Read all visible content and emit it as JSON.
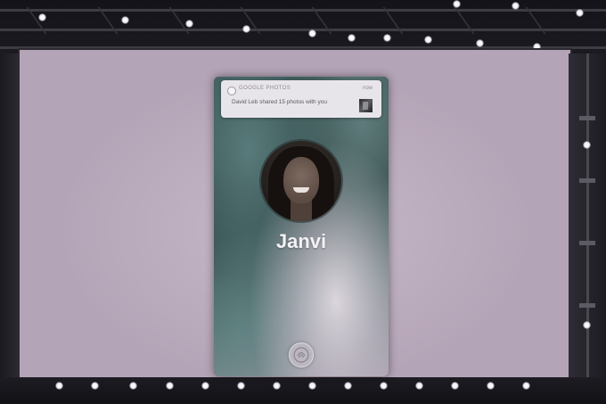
{
  "notification": {
    "app_icon": "google-photos-icon",
    "app_name": "GOOGLE PHOTOS",
    "time": "now",
    "message": "David Leb shared 15 photos with you",
    "thumbnail": "shared-photo-thumbnail"
  },
  "contact": {
    "name": "Janvi",
    "avatar": "contact-photo"
  },
  "action": {
    "icon": "fingerprint-icon"
  },
  "colors": {
    "screen": "#b4a4b7",
    "notification_bg": "#e8e5ea",
    "name_text": "#f3f1f5"
  }
}
